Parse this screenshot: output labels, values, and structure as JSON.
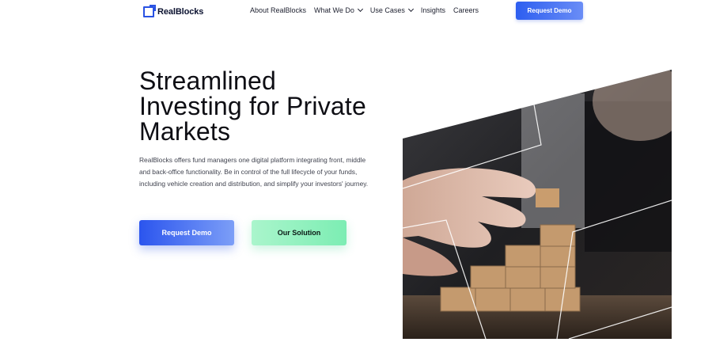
{
  "header": {
    "logo_text": "RealBlocks",
    "nav": [
      {
        "label": "About RealBlocks",
        "has_dropdown": false
      },
      {
        "label": "What We Do",
        "has_dropdown": true
      },
      {
        "label": "Use Cases",
        "has_dropdown": true
      },
      {
        "label": "Insights",
        "has_dropdown": false
      },
      {
        "label": "Careers",
        "has_dropdown": false
      }
    ],
    "cta_label": "Request Demo"
  },
  "hero": {
    "title_lines": [
      "Streamlined",
      "Investing for Private",
      "Markets"
    ],
    "description": "RealBlocks offers fund managers one digital platform integrating front, middle and back-office functionality. Be in control of the full lifecycle of your funds, including vehicle creation and distribution, and simplify your investors' journey.",
    "primary_button": "Request Demo",
    "secondary_button": "Our Solution"
  },
  "colors": {
    "brand_blue": "#2d5ef0",
    "mint": "#8ef0bf",
    "text_dark": "#0e0e14"
  }
}
